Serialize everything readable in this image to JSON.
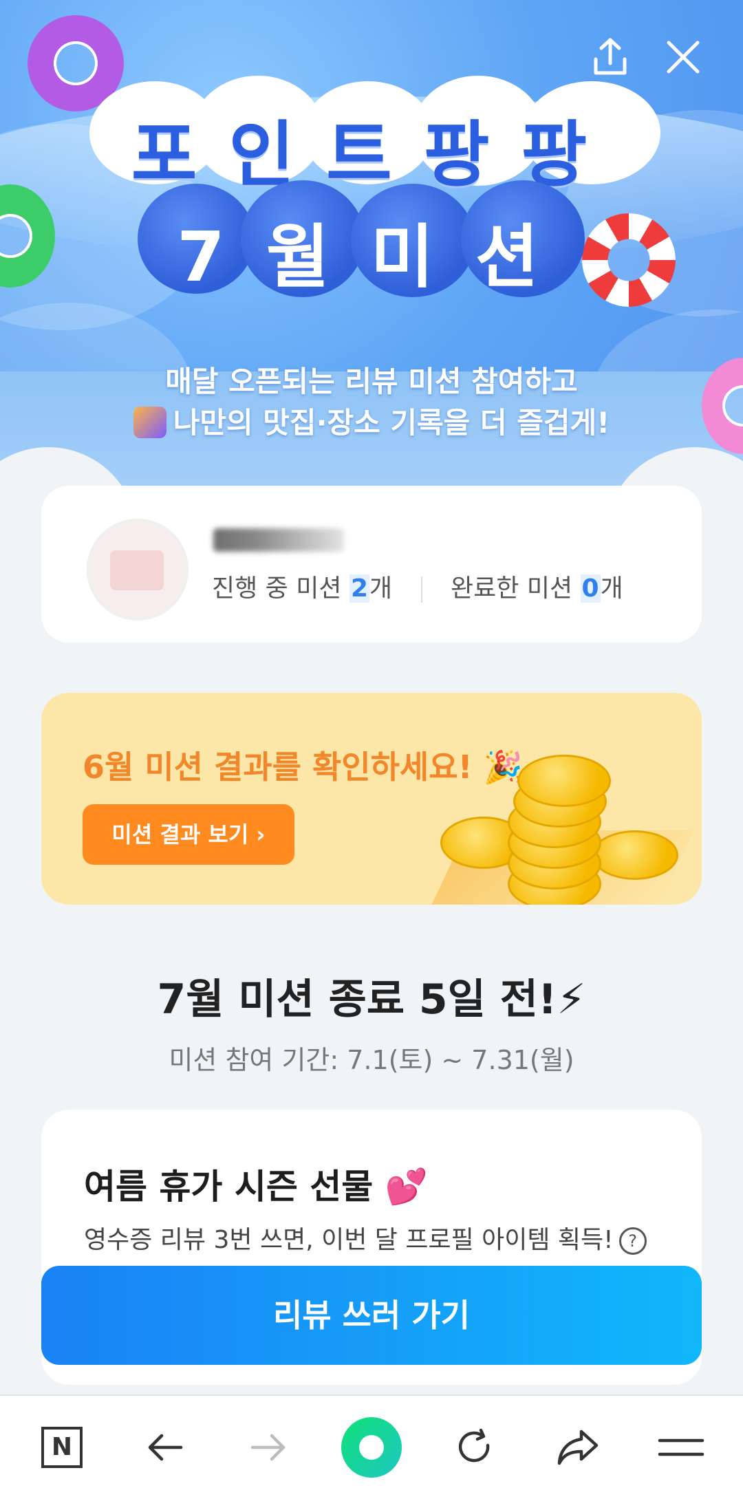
{
  "header": {
    "title": "포인트팡팡",
    "subtitle": "7월미션",
    "caption_line1": "매달 오픈되는 리뷰 미션 참여하고",
    "caption_line2": "나만의 맛집·장소 기록을 더 즐겁게!",
    "share_icon": "share-icon",
    "close_icon": "close-icon"
  },
  "profile": {
    "in_progress_label": "진행 중 미션",
    "in_progress_count": "2",
    "completed_label": "완료한 미션",
    "completed_count": "0",
    "unit": "개"
  },
  "result_banner": {
    "title": "6월 미션 결과를 확인하세요! 🎉",
    "button_label": "미션 결과 보기 ›"
  },
  "countdown": {
    "title": "7월 미션 종료 5일 전!⚡",
    "period": "미션 참여 기간: 7.1(토) ~ 7.31(월)"
  },
  "mission": {
    "title": "여름 휴가 시즌 선물 💕",
    "description": "영수증 리뷰 3번 쓰면, 이번 달 프로필 아이템 획득!",
    "help": "?",
    "cta_label": "리뷰 쓰러 가기"
  },
  "bottom_nav": {
    "home_letter": "N",
    "items": [
      "naver-home-icon",
      "back-arrow-icon",
      "forward-arrow-icon",
      "green-dot-icon",
      "refresh-icon",
      "share-arrow-icon",
      "menu-icon"
    ]
  },
  "colors": {
    "accent_blue": "#2f80ed",
    "orange": "#ff8a1f",
    "banner_bg": "#fde7a8",
    "cta_start": "#1a82f5",
    "cta_end": "#11b7fb"
  }
}
